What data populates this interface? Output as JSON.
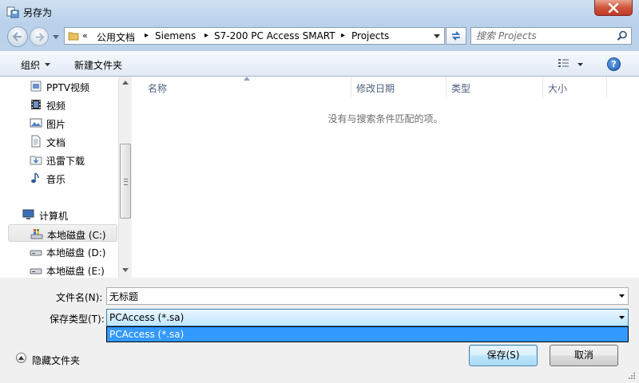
{
  "window": {
    "title": "另存为"
  },
  "address": {
    "overflow": "«",
    "segments": [
      "公用文档",
      "Siemens",
      "S7-200 PC Access SMART",
      "Projects"
    ],
    "separator": "▸"
  },
  "search": {
    "placeholder": "搜索 Projects"
  },
  "toolbar": {
    "organize_label": "组织",
    "new_folder_label": "新建文件夹",
    "help_label": "?"
  },
  "nav": {
    "items": [
      {
        "label": "PPTV视频",
        "icon": "video-folder-icon"
      },
      {
        "label": "视频",
        "icon": "film-icon"
      },
      {
        "label": "图片",
        "icon": "picture-icon"
      },
      {
        "label": "文档",
        "icon": "document-icon"
      },
      {
        "label": "迅雷下载",
        "icon": "download-folder-icon"
      },
      {
        "label": "音乐",
        "icon": "music-icon"
      },
      {
        "label": "计算机",
        "icon": "computer-icon"
      },
      {
        "label": "本地磁盘 (C:)",
        "icon": "system-drive-icon"
      },
      {
        "label": "本地磁盘 (D:)",
        "icon": "drive-icon"
      },
      {
        "label": "本地磁盘 (E:)",
        "icon": "drive-icon"
      }
    ]
  },
  "file_list": {
    "columns": [
      "名称",
      "修改日期",
      "类型",
      "大小"
    ],
    "empty_message": "没有与搜索条件匹配的项。"
  },
  "form": {
    "filename_label": "文件名(N):",
    "filename_value": "无标题",
    "filetype_label": "保存类型(T):",
    "filetype_value": "PCAccess (*.sa)",
    "filetype_options": [
      "PCAccess (*.sa)"
    ]
  },
  "footer": {
    "hide_folders_label": "隐藏文件夹",
    "save_label": "保存(S)",
    "cancel_label": "取消"
  },
  "colors": {
    "accent": "#3399ff",
    "title_bg": "#b9d1ea",
    "close": "#c13a26"
  }
}
